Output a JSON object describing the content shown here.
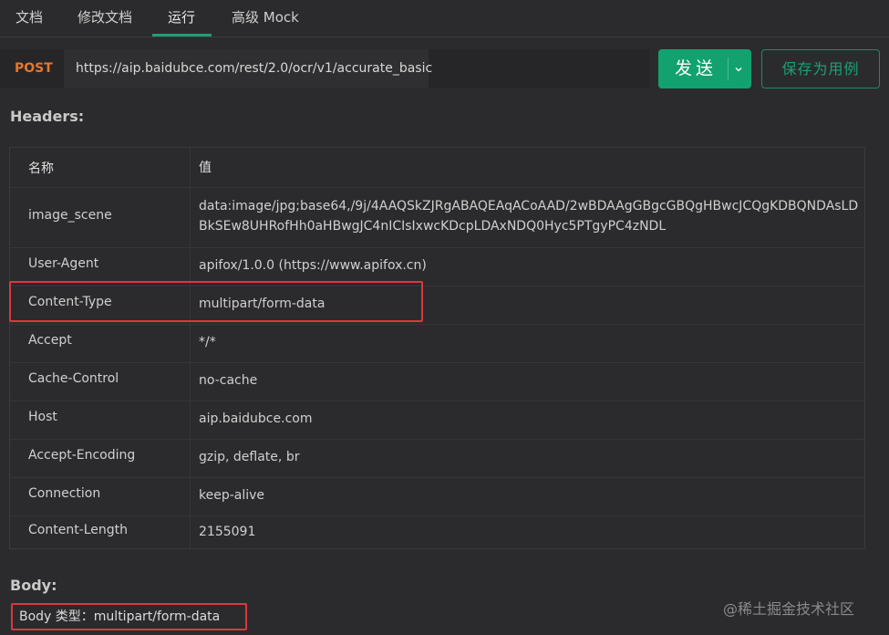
{
  "tabs": [
    {
      "label": "文档"
    },
    {
      "label": "修改文档"
    },
    {
      "label": "运行"
    },
    {
      "label": "高级 Mock"
    }
  ],
  "request": {
    "method": "POST",
    "url": "https://aip.baidubce.com/rest/2.0/ocr/v1/accurate_basic",
    "send_label": "发送",
    "save_label": "保存为用例"
  },
  "headers": {
    "title": "Headers:",
    "col_name": "名称",
    "col_value": "值",
    "rows": [
      {
        "name": "image_scene",
        "value": "data:image/jpg;base64,/9j/4AAQSkZJRgABAQEAqACoAAD/2wBDAAgGBgcGBQgHBwcJCQgKDBQNDAsLDBkSEw8UHRofHh0aHBwgJC4nICIsIxwcKDcpLDAxNDQ0Hyc5PTgyPC4zNDL"
      },
      {
        "name": "User-Agent",
        "value": "apifox/1.0.0 (https://www.apifox.cn)"
      },
      {
        "name": "Content-Type",
        "value": "multipart/form-data"
      },
      {
        "name": "Accept",
        "value": "*/*"
      },
      {
        "name": "Cache-Control",
        "value": "no-cache"
      },
      {
        "name": "Host",
        "value": "aip.baidubce.com"
      },
      {
        "name": "Accept-Encoding",
        "value": "gzip, deflate, br"
      },
      {
        "name": "Connection",
        "value": "keep-alive"
      },
      {
        "name": "Content-Length",
        "value": "2155091"
      }
    ]
  },
  "body": {
    "title": "Body:",
    "type_label": "Body 类型：multipart/form-data"
  },
  "watermark": "@稀土掘金技术社区",
  "colors": {
    "accent": "#12a26f",
    "method": "#e4772a",
    "highlight": "#d9393e"
  },
  "icons": {
    "send_dropdown": "chevron-down-icon"
  }
}
